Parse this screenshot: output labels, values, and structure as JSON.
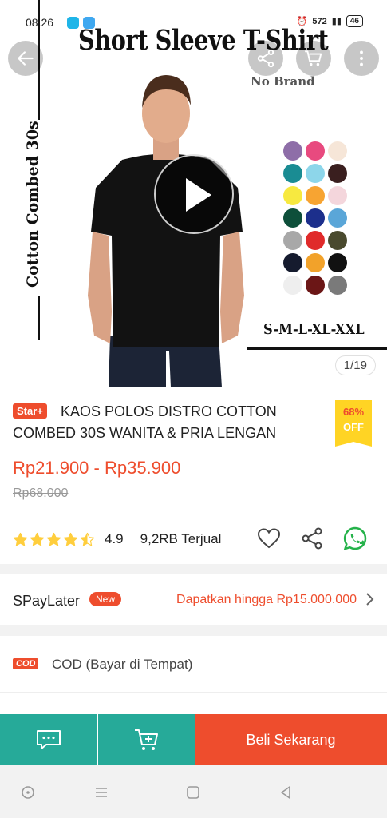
{
  "status_bar": {
    "time": "08.26",
    "speed": "572",
    "battery": "46"
  },
  "hero": {
    "banner_title": "Short Sleeve T-Shirt",
    "brand": "No Brand",
    "vertical_text": "Cotton Combed 30s",
    "sizes": "S-M-L-XL-XXL",
    "image_counter": "1/19",
    "swatch_colors": [
      "#8e6ea8",
      "#e84a7f",
      "#f6e6d8",
      "#1a8c93",
      "#8dd6ea",
      "#3a1f1f",
      "#f7e940",
      "#f7a432",
      "#f4d6dc",
      "#0e4f3a",
      "#1c2f8c",
      "#5aa6d8",
      "#a8a8a8",
      "#e02a2a",
      "#4a4a2e",
      "#151b2e",
      "#f2a22a",
      "#111111",
      "#eeeeee",
      "#6b1616",
      "#7a7a7a"
    ]
  },
  "product": {
    "badge": "Star+",
    "title": "KAOS POLOS DISTRO COTTON COMBED 30S WANITA & PRIA LENGAN",
    "discount_pct": "68%",
    "discount_off": "OFF",
    "price": "Rp21.900 - Rp35.900",
    "original_price": "Rp68.000",
    "rating": "4.9",
    "stars_value": 4.5,
    "sold": "9,2RB Terjual"
  },
  "spaylater": {
    "label": "SPayLater",
    "new_badge": "New",
    "promo": "Dapatkan hingga Rp15.000.000"
  },
  "cod": {
    "logo": "COD",
    "label": "COD (Bayar di Tempat)"
  },
  "actions": {
    "buy_now": "Beli Sekarang"
  },
  "colors": {
    "accent": "#ee4d2d",
    "teal": "#26aa99",
    "star": "#ffce3d"
  }
}
